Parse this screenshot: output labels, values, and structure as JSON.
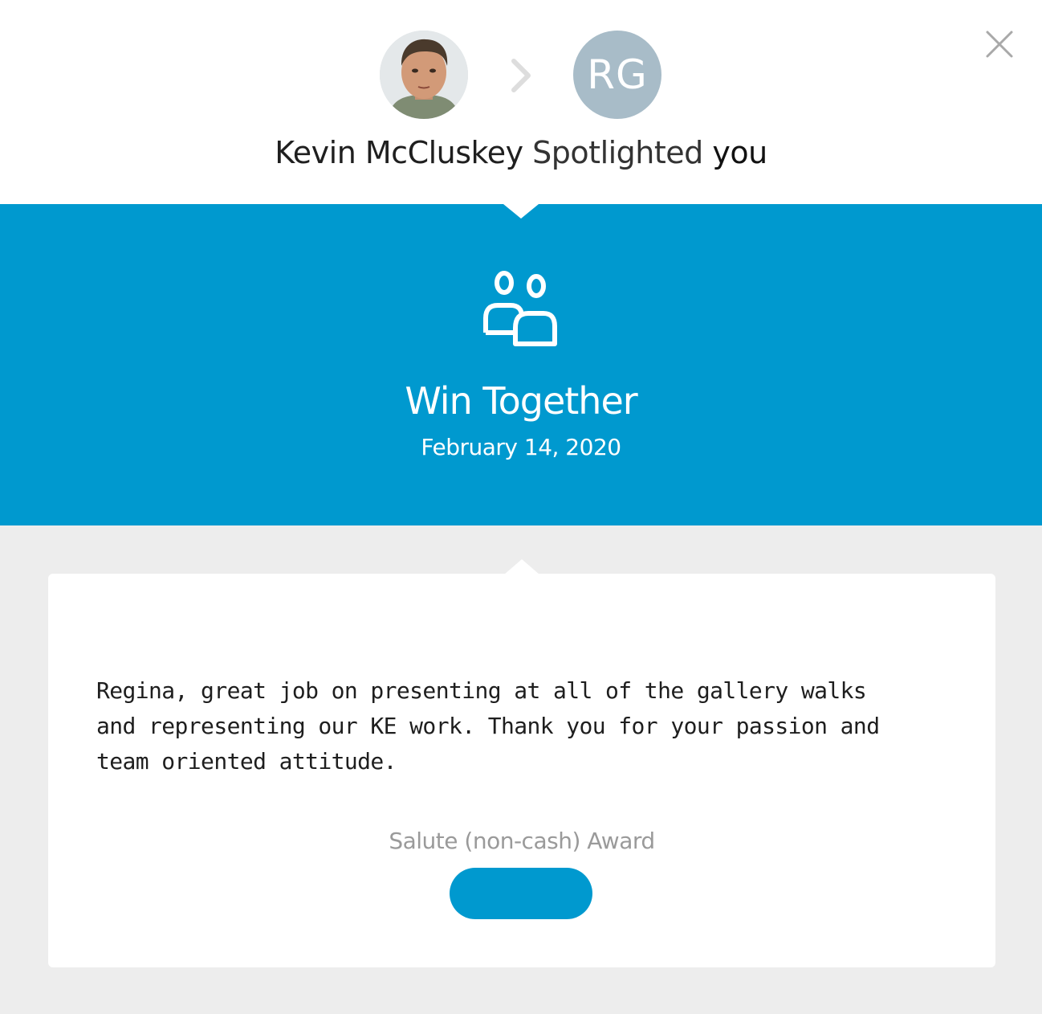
{
  "header": {
    "sender_name": "Kevin McCluskey",
    "action": "Spotlighted",
    "recipient": "you",
    "recipient_initials": "RG",
    "sender_avatar_icon": "person-photo",
    "arrow_icon": "chevron-right-icon",
    "close_icon": "close-icon"
  },
  "value": {
    "icon": "people-group-icon",
    "title": "Win Together",
    "date": "February 14, 2020"
  },
  "message": {
    "text": "Regina, great job on presenting at all of the gallery walks and representing our KE work. Thank you for your passion and team oriented attitude."
  },
  "award": {
    "label": "Salute (non-cash) Award",
    "button_label": ""
  },
  "colors": {
    "accent": "#0099cf",
    "recipient_avatar": "#a8bcc8",
    "page_background": "#ededed",
    "card_background": "#ffffff"
  }
}
